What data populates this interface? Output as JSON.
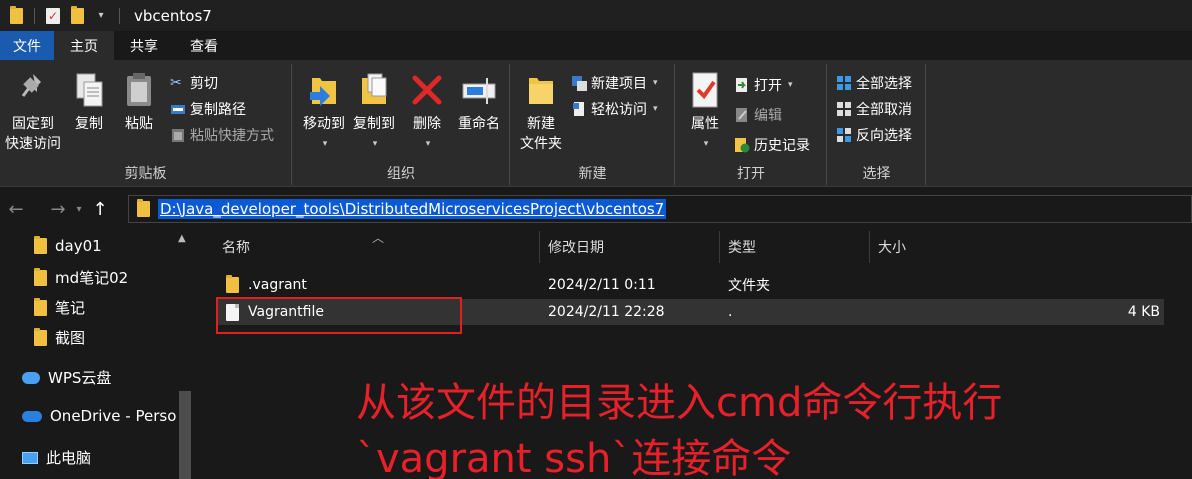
{
  "window": {
    "title": "vbcentos7",
    "quick_access_dropdown": "▾"
  },
  "menu": {
    "tabs": [
      {
        "label": "文件"
      },
      {
        "label": "主页"
      },
      {
        "label": "共享"
      },
      {
        "label": "查看"
      }
    ],
    "active_tab": "主页"
  },
  "ribbon": {
    "clipboard": {
      "label": "剪贴板",
      "pin_line1": "固定到",
      "pin_line2": "快速访问",
      "copy": "复制",
      "paste": "粘贴",
      "cut": "剪切",
      "copy_path": "复制路径",
      "paste_shortcut": "粘贴快捷方式"
    },
    "organize": {
      "label": "组织",
      "move_to": "移动到",
      "copy_to": "复制到",
      "delete": "删除",
      "rename": "重命名"
    },
    "new": {
      "label": "新建",
      "new_folder_line1": "新建",
      "new_folder_line2": "文件夹",
      "new_item": "新建项目",
      "easy_access": "轻松访问"
    },
    "open": {
      "label": "打开",
      "properties": "属性",
      "open": "打开",
      "edit": "编辑",
      "history": "历史记录"
    },
    "select": {
      "label": "选择",
      "select_all": "全部选择",
      "select_none": "全部取消",
      "invert": "反向选择"
    }
  },
  "address": {
    "path": "D:\\Java_developer_tools\\DistributedMicroservicesProject\\vbcentos7"
  },
  "nav_pane": {
    "items": [
      {
        "label": "day01"
      },
      {
        "label": "md笔记02"
      },
      {
        "label": "笔记"
      },
      {
        "label": "截图"
      },
      {
        "label": "WPS云盘"
      },
      {
        "label": "OneDrive - Person"
      },
      {
        "label": "此电脑"
      }
    ]
  },
  "file_list": {
    "columns": {
      "name": "名称",
      "date": "修改日期",
      "type": "类型",
      "size": "大小"
    },
    "rows": [
      {
        "name": ".vagrant",
        "date": "2024/2/11 0:11",
        "type": "文件夹",
        "size": ""
      },
      {
        "name": "Vagrantfile",
        "date": "2024/2/11 22:28",
        "type": ".",
        "size": "4 KB"
      }
    ]
  },
  "annotation": {
    "line1": "从该文件的目录进入cmd命令行执行",
    "line2": "`vagrant ssh`连接命令"
  },
  "colors": {
    "accent": "#1a5bb0",
    "selection": "#0a5ad6",
    "annotation": "#e8202a"
  }
}
